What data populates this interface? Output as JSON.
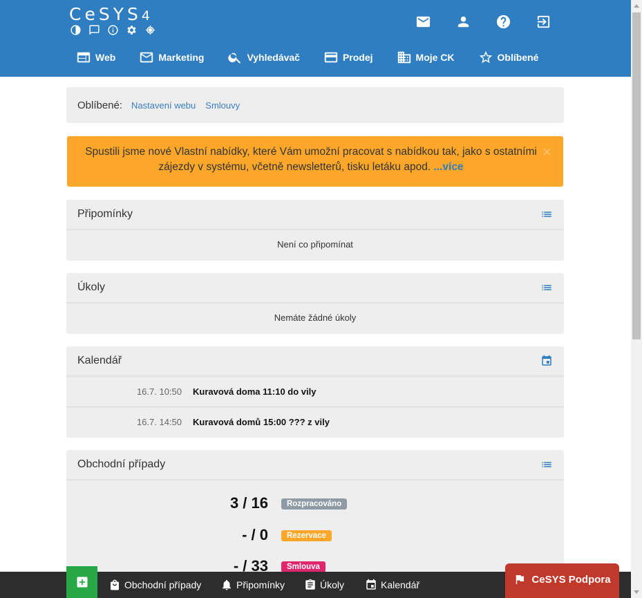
{
  "header": {
    "logo_text": "CeSYS",
    "logo_version": "4",
    "logo_icons": [
      "contrast-icon",
      "chat-icon",
      "info-icon",
      "gear-icon",
      "target-icon"
    ],
    "top_actions": [
      "mail-icon",
      "user-icon",
      "help-icon",
      "logout-icon"
    ],
    "nav": [
      {
        "label": "Web",
        "icon": "web-icon"
      },
      {
        "label": "Marketing",
        "icon": "mail-icon"
      },
      {
        "label": "Vyhledávač",
        "icon": "search-icon"
      },
      {
        "label": "Prodej",
        "icon": "card-icon"
      },
      {
        "label": "Moje CK",
        "icon": "building-icon"
      },
      {
        "label": "Oblíbené",
        "icon": "star-icon"
      }
    ]
  },
  "favorites": {
    "label": "Oblíbené:",
    "links": [
      "Nastavení webu",
      "Smlouvy"
    ]
  },
  "alert": {
    "text": "Spustili jsme nové Vlastní nabídky, které Vám umožní pracovat s nabídkou tak, jako s ostatními zájezdy v systému, včetně newsletterů, tisku letáku apod.",
    "more_label": "...více",
    "close_label": "×",
    "color": "#fca72a"
  },
  "panels": {
    "reminders": {
      "title": "Připomínky",
      "empty": "Není co připomínat"
    },
    "tasks": {
      "title": "Úkoly",
      "empty": "Nemáte žádné úkoly"
    },
    "calendar": {
      "title": "Kalendář",
      "events": [
        {
          "time": "16.7. 10:50",
          "title": "Kuravová doma 11:10 do vily"
        },
        {
          "time": "16.7. 14:50",
          "title": "Kuravová domů 15:00 ??? z vily"
        }
      ]
    },
    "deals": {
      "title": "Obchodní případy",
      "stats": [
        {
          "value": "3 / 16",
          "status": "Rozpracováno",
          "color": "#8e9aa4"
        },
        {
          "value": "- / 0",
          "status": "Rezervace",
          "color": "#fca72a"
        },
        {
          "value": "- / 33",
          "status": "Smlouva",
          "color": "#e0266d"
        }
      ]
    }
  },
  "bottom_bar": {
    "add_label": "+",
    "items": [
      {
        "label": "Obchodní případy",
        "icon": "bag-icon"
      },
      {
        "label": "Připomínky",
        "icon": "bell-icon"
      },
      {
        "label": "Úkoly",
        "icon": "clipboard-icon"
      },
      {
        "label": "Kalendář",
        "icon": "calendar-icon"
      }
    ],
    "support_label": "CeSYS Podpora"
  }
}
